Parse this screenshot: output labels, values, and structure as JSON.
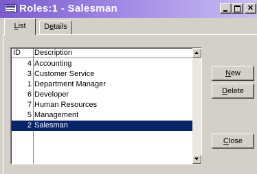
{
  "window": {
    "title": "Roles:1 - Salesman",
    "controls": {
      "minimize": "",
      "maximize": "",
      "close": "✕"
    }
  },
  "tabs": [
    {
      "label": "List",
      "accel": "L",
      "rest": "ist",
      "active": true
    },
    {
      "label": "Details",
      "accel_pre": "D",
      "accel": "e",
      "rest": "tails",
      "active": false
    }
  ],
  "list": {
    "columns": [
      "ID",
      "Description"
    ],
    "rows": [
      {
        "id": "4",
        "description": "Accounting"
      },
      {
        "id": "3",
        "description": "Customer Service"
      },
      {
        "id": "1",
        "description": "Department Manager"
      },
      {
        "id": "6",
        "description": "Developer"
      },
      {
        "id": "7",
        "description": "Human Resources"
      },
      {
        "id": "5",
        "description": "Management"
      },
      {
        "id": "2",
        "description": "Salesman"
      }
    ],
    "selected_index": 6
  },
  "buttons": {
    "new": {
      "label": "New",
      "accel": "N",
      "rest": "ew"
    },
    "delete": {
      "label": "Delete",
      "accel": "D",
      "rest": "elete"
    },
    "close": {
      "label": "Close",
      "accel": "C",
      "rest": "lose"
    }
  },
  "colors": {
    "titlebar_start": "#7a5ad0",
    "selection": "#0a246a",
    "face": "#d4d0c8"
  }
}
